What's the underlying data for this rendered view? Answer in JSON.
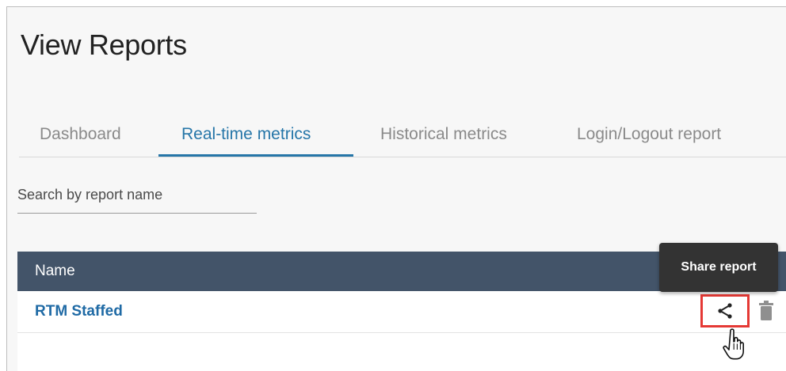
{
  "page": {
    "title": "View Reports"
  },
  "tabs": [
    {
      "label": "Dashboard",
      "active": false
    },
    {
      "label": "Real-time metrics",
      "active": true
    },
    {
      "label": "Historical metrics",
      "active": false
    },
    {
      "label": "Login/Logout report",
      "active": false
    }
  ],
  "search": {
    "placeholder": "Search by report name",
    "value": ""
  },
  "table": {
    "columns": [
      "Name"
    ],
    "rows": [
      {
        "name": "RTM Staffed"
      }
    ]
  },
  "actions": {
    "share_icon": "share-icon",
    "delete_icon": "trash-icon",
    "tooltip": "Share report"
  },
  "colors": {
    "accent": "#2676a8",
    "header_bg": "#435469",
    "highlight": "#e53935",
    "link": "#1f6aa5"
  }
}
